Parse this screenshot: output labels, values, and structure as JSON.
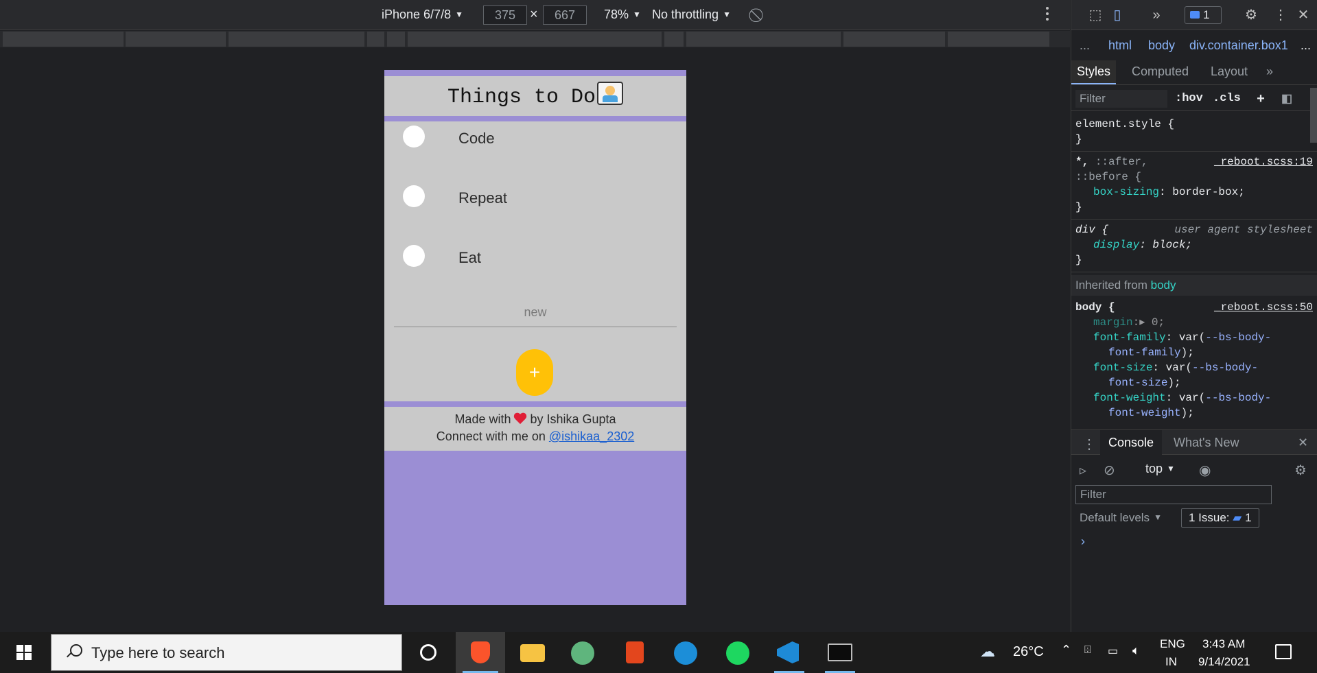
{
  "device_toolbar": {
    "device": "iPhone 6/7/8",
    "width": "375",
    "times": "×",
    "height": "667",
    "zoom": "78%",
    "throttling": "No throttling"
  },
  "app": {
    "title": "Things to Do",
    "todos": [
      {
        "label": "Code",
        "done": false
      },
      {
        "label": "Repeat",
        "done": false
      },
      {
        "label": "Eat",
        "done": false
      }
    ],
    "new_placeholder": "new",
    "add_label": "+",
    "footer": {
      "made_with": "Made with",
      "by": "by Ishika Gupta",
      "connect": "Connect with me on",
      "handle": "@ishikaa_2302"
    },
    "colors": {
      "accent": "#9b8ed4",
      "panel": "#c9c9c9",
      "button": "#ffc107",
      "heart": "#e01e37"
    }
  },
  "devtools": {
    "issue_count": "1",
    "breadcrumbs": [
      "...",
      "html",
      "body",
      "div.container.box1",
      "..."
    ],
    "tabs": [
      "Styles",
      "Computed",
      "Layout",
      "»"
    ],
    "filter_placeholder": "Filter",
    "hov": ":hov",
    "cls": ".cls",
    "rules": {
      "element_style": "element.style {",
      "close": "}",
      "universal_selector_a": "*, ",
      "universal_selector_b": "::after,",
      "universal_selector_c": "::before {",
      "reboot19": "_reboot.scss:19",
      "box_sizing_prop": "box-sizing",
      "box_sizing_val": "border-box;",
      "div_sel": "div {",
      "ua": "user agent stylesheet",
      "display_prop": "display",
      "display_val": "block;",
      "inherited": "Inherited from",
      "inherited_from": "body",
      "body_sel": "body {",
      "reboot50": "_reboot.scss:50",
      "margin_prop": "margin",
      "margin_val": "▸ 0;",
      "ff_prop": "font-family",
      "ff_val_a": "var(",
      "ff_val_var": "--bs-body-",
      "ff_val_b": "font-family",
      "ff_val_c": ");",
      "fs_prop": "font-size",
      "fs_val_b": "font-size",
      "fw_prop": "font-weight",
      "fw_val_b": "font-weight"
    },
    "drawer": {
      "tabs": [
        "Console",
        "What's New"
      ],
      "context": "top",
      "filter_placeholder": "Filter",
      "levels": "Default levels",
      "issues_label": "1 Issue:",
      "issues_count": "1",
      "prompt": "›"
    }
  },
  "taskbar": {
    "search_placeholder": "Type here to search",
    "weather": "26°C",
    "lang_top": "ENG",
    "lang_bottom": "IN",
    "time": "3:43 AM",
    "date": "9/14/2021",
    "apps": [
      "brave-icon",
      "file-explorer-icon",
      "atom-icon",
      "office-icon",
      "edge-icon",
      "spotify-icon",
      "vscode-icon",
      "terminal-icon"
    ]
  }
}
